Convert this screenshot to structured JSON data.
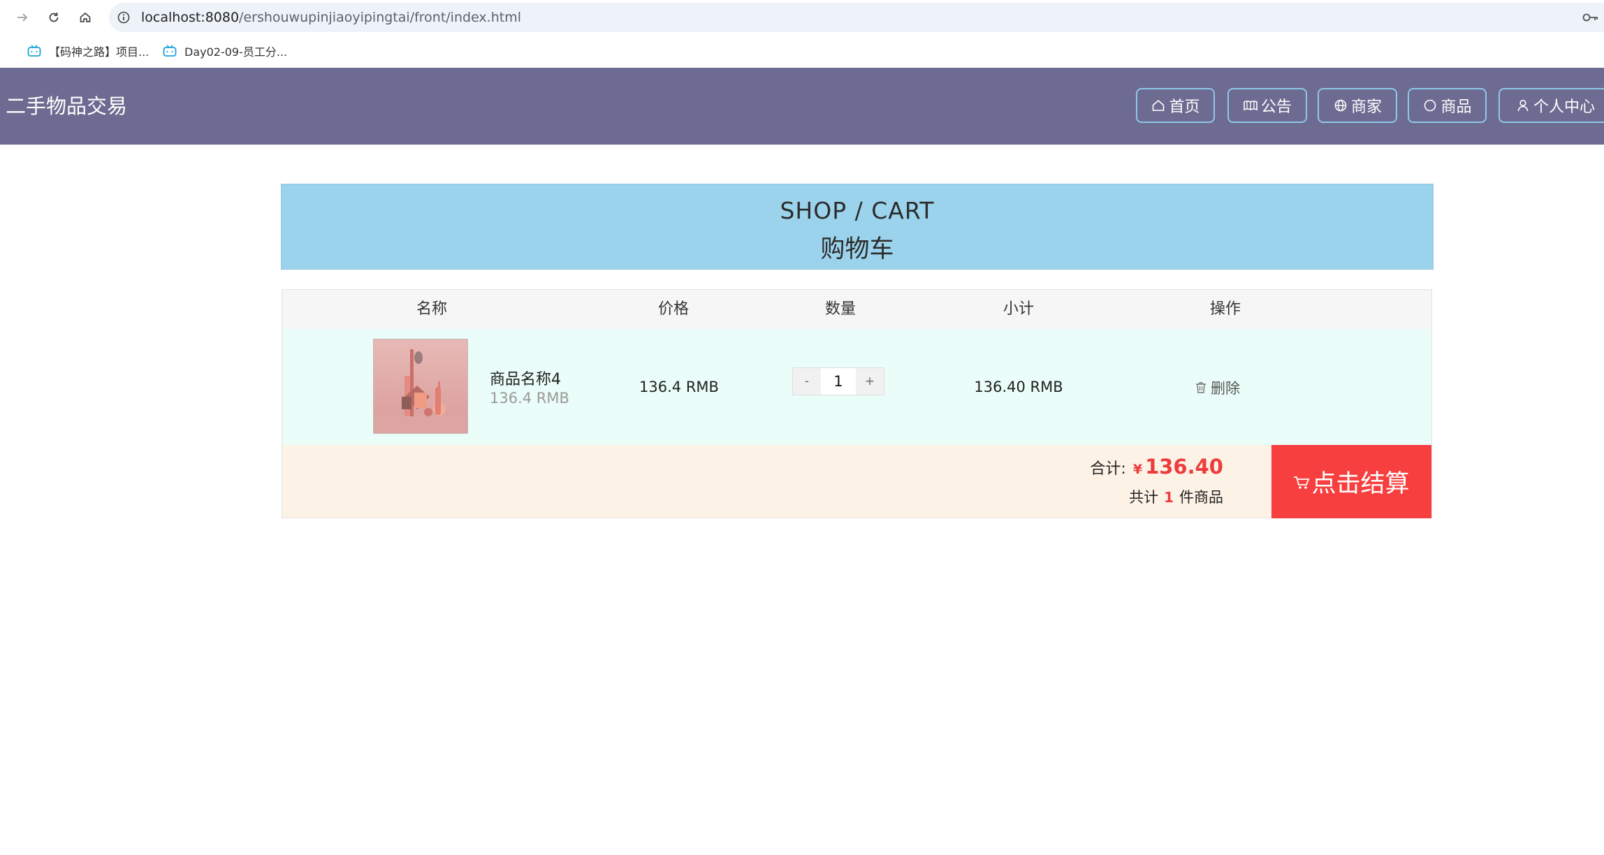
{
  "browser": {
    "url_host": "localhost:8080",
    "url_path": "/ershouwupinjiaoyipingtai/front/index.html",
    "bookmarks": [
      {
        "label": "【码神之路】项目..."
      },
      {
        "label": "Day02-09-员工分..."
      }
    ]
  },
  "site": {
    "title": "二手物品交易",
    "nav": [
      {
        "label": "首页",
        "icon": "home-icon"
      },
      {
        "label": "公告",
        "icon": "book-icon"
      },
      {
        "label": "商家",
        "icon": "globe-icon"
      },
      {
        "label": "商品",
        "icon": "circle-icon"
      },
      {
        "label": "个人中心",
        "icon": "user-icon"
      }
    ]
  },
  "banner": {
    "en": "SHOP / CART",
    "cn": "购物车"
  },
  "cart": {
    "headers": [
      "名称",
      "价格",
      "数量",
      "小计",
      "操作"
    ],
    "items": [
      {
        "name": "商品名称4",
        "price_sub": "136.4 RMB",
        "price": "136.4 RMB",
        "qty": "1",
        "minus": "-",
        "plus": "+",
        "subtotal": "136.40 RMB",
        "delete_label": "删除"
      }
    ],
    "total_label": "合计:",
    "currency": "¥",
    "total": "136.40",
    "count_prefix": "共计",
    "count": "1",
    "count_suffix": "件商品",
    "checkout_label": "点击结算"
  },
  "colors": {
    "header_bg": "#6d6b91",
    "banner_bg": "#9bd3ec",
    "row_bg": "#eafdf8",
    "footer_bg": "#fcf2e6",
    "accent_red": "#f73f3f"
  }
}
